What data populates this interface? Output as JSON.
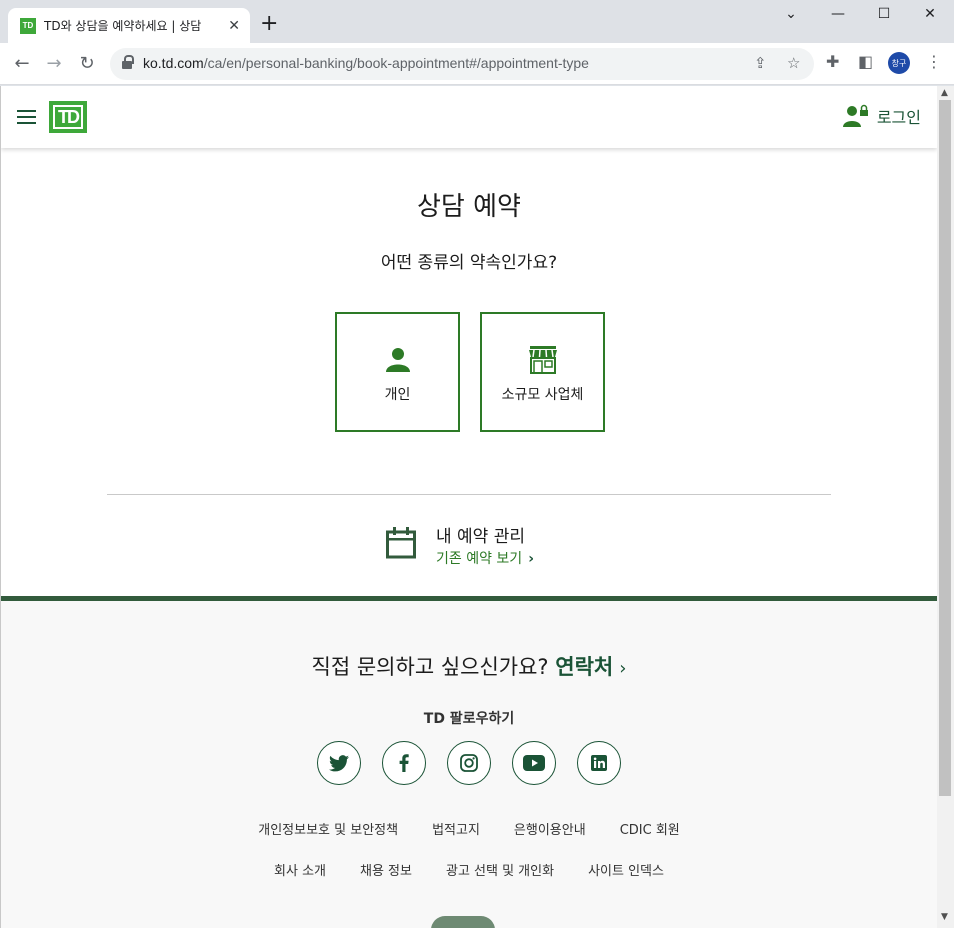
{
  "browser": {
    "tab_title": "TD와 상담을 예약하세요 | 상담",
    "tab_favicon": "TD",
    "url_host": "ko.td.com",
    "url_path": "/ca/en/personal-banking/book-appointment#/appointment-type",
    "profile_initials": "창구"
  },
  "header": {
    "logo_text": "TD",
    "login_label": "로그인"
  },
  "main": {
    "title": "상담 예약",
    "question": "어떤 종류의 약속인가요?",
    "choices": [
      {
        "label": "개인",
        "icon": "person-icon"
      },
      {
        "label": "소규모 사업체",
        "icon": "storefront-icon"
      }
    ]
  },
  "manage": {
    "title": "내 예약 관리",
    "link": "기존 예약 보기",
    "chevron": "›"
  },
  "footer": {
    "contact_prefix": "직접 문의하고 싶으신가요?",
    "contact_link": "연락처",
    "contact_chevron": "›",
    "follow_label": "TD 팔로우하기",
    "socials": [
      "twitter",
      "facebook",
      "instagram",
      "youtube",
      "linkedin"
    ],
    "links_row1": [
      "개인정보보호 및 보안정책",
      "법적고지",
      "은행이용안내",
      "CDIC 회원"
    ],
    "links_row2": [
      "회사 소개",
      "채용 정보",
      "광고 선택 및 개인화",
      "사이트 인덱스"
    ]
  },
  "colors": {
    "brand_green": "#3ea83a",
    "dark_green": "#1a5336",
    "footer_border": "#325b3c"
  }
}
